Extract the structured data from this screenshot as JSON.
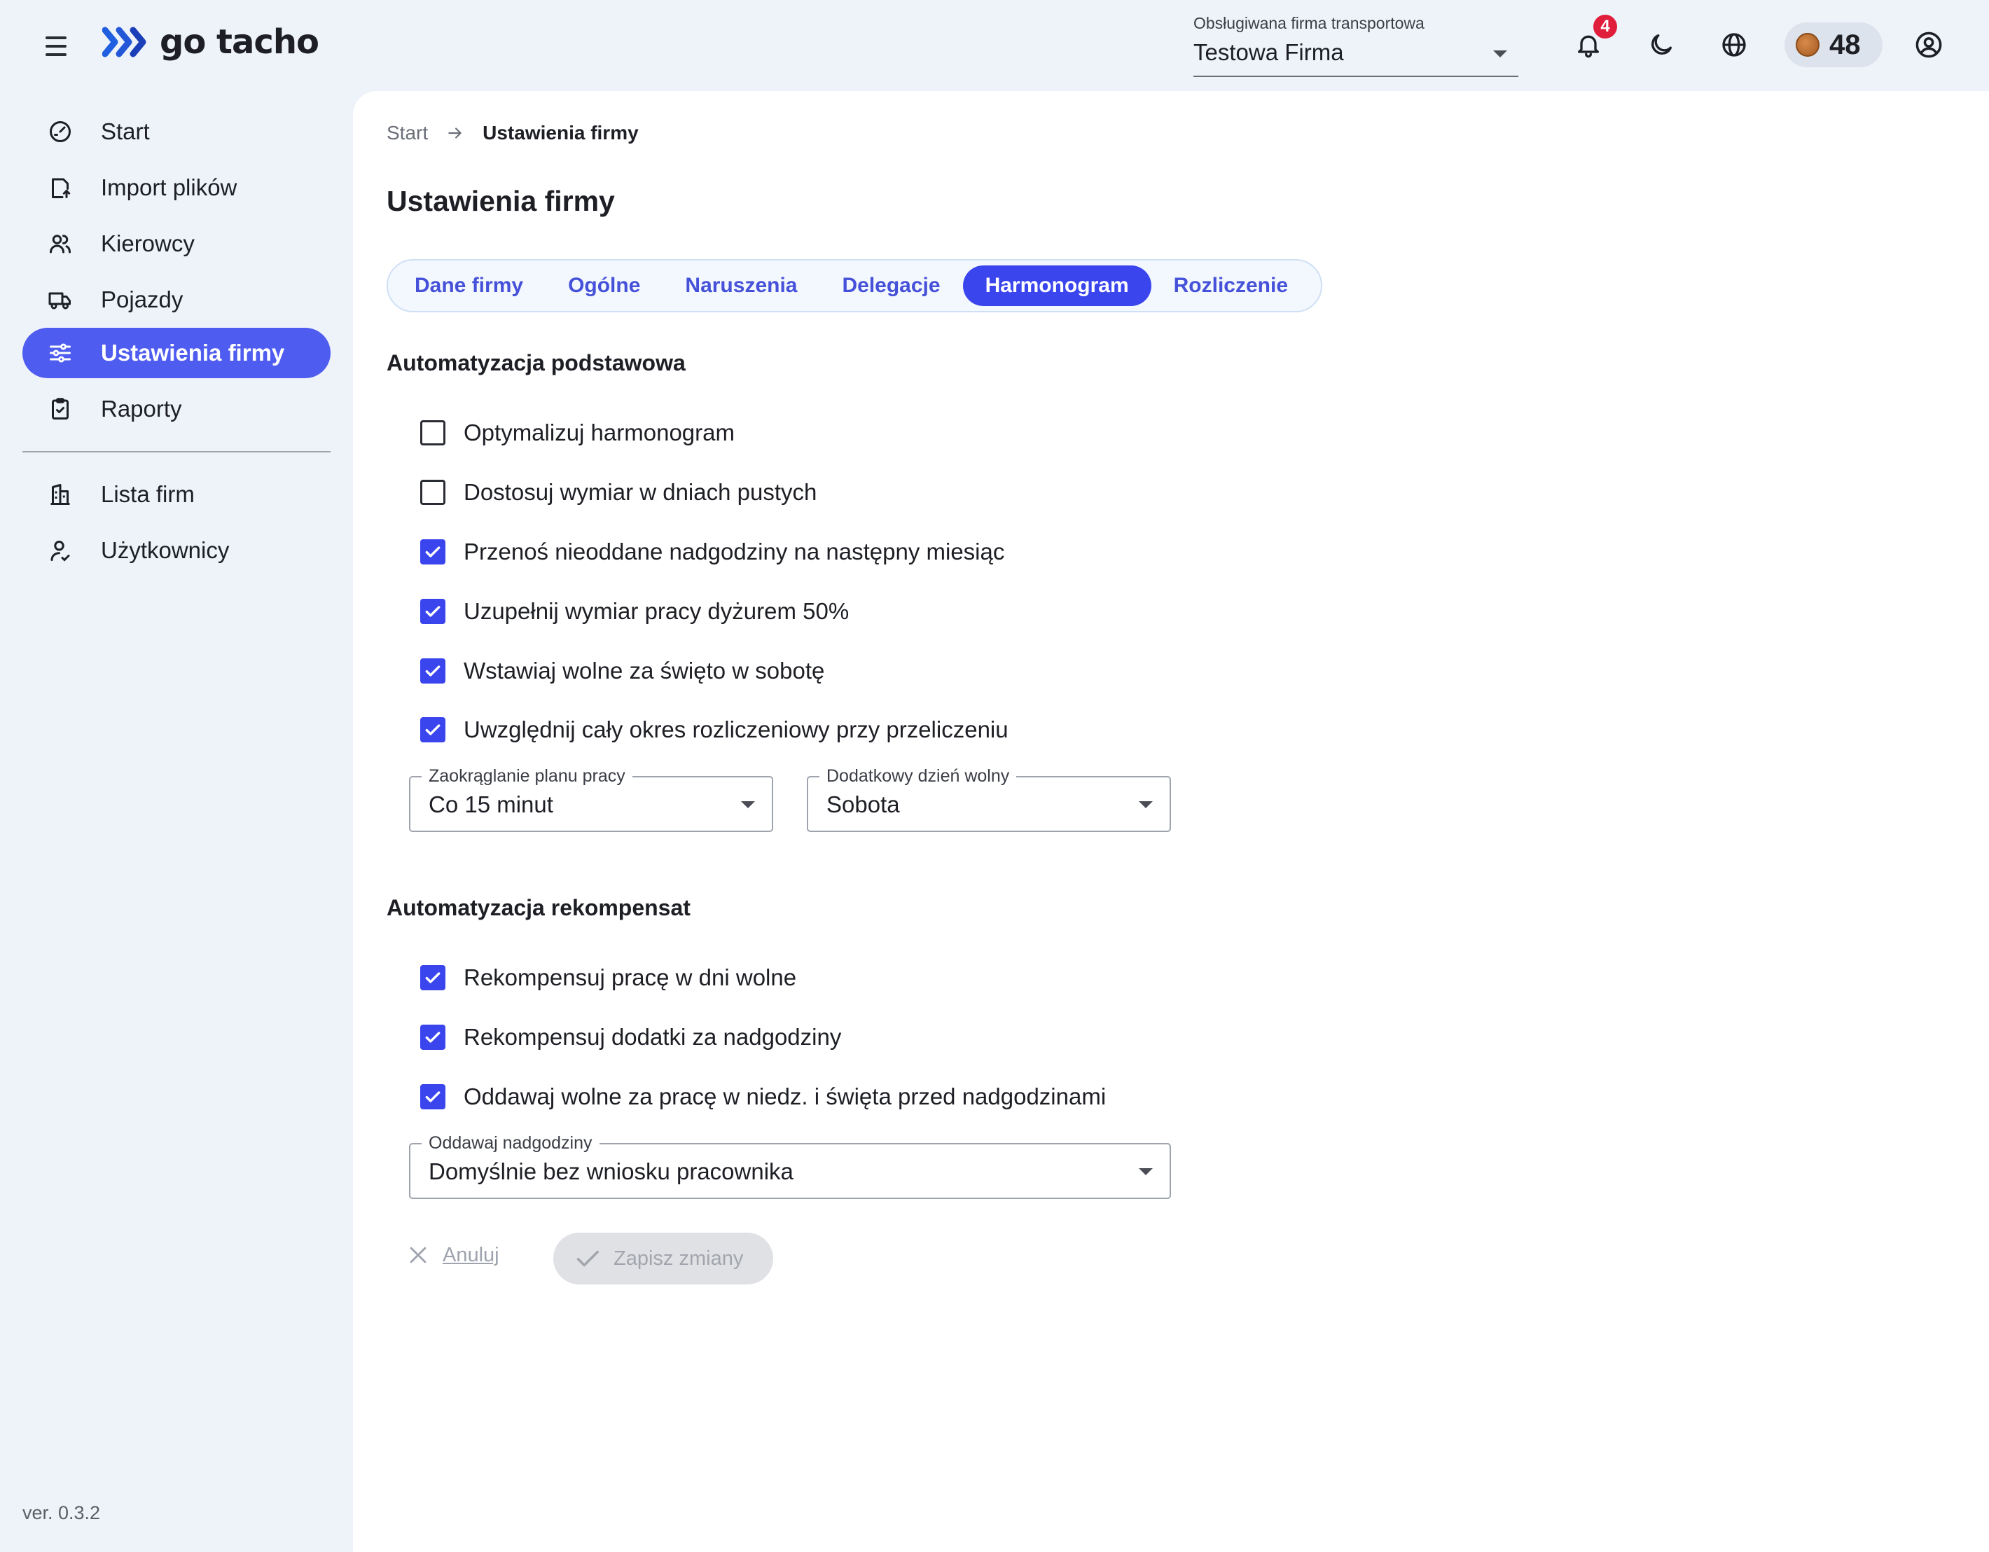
{
  "app": {
    "name": "go tacho",
    "version": "ver. 0.3.2"
  },
  "header": {
    "company_select_label": "Obsługiwana firma transportowa",
    "company_select_value": "Testowa Firma",
    "notifications_count": "4",
    "coins": "48"
  },
  "sidebar": {
    "items": [
      {
        "label": "Start",
        "icon": "speedometer-icon"
      },
      {
        "label": "Import plików",
        "icon": "file-import-icon"
      },
      {
        "label": "Kierowcy",
        "icon": "users-icon"
      },
      {
        "label": "Pojazdy",
        "icon": "truck-icon"
      },
      {
        "label": "Ustawienia firmy",
        "icon": "sliders-icon",
        "active": true
      },
      {
        "label": "Raporty",
        "icon": "clipboard-icon"
      }
    ],
    "secondary_items": [
      {
        "label": "Lista firm",
        "icon": "building-icon"
      },
      {
        "label": "Użytkownicy",
        "icon": "user-icon"
      }
    ]
  },
  "breadcrumb": {
    "start": "Start",
    "current": "Ustawienia firmy"
  },
  "page_title": "Ustawienia firmy",
  "tabs": [
    {
      "label": "Dane firmy"
    },
    {
      "label": "Ogólne"
    },
    {
      "label": "Naruszenia"
    },
    {
      "label": "Delegacje"
    },
    {
      "label": "Harmonogram",
      "active": true
    },
    {
      "label": "Rozliczenie"
    }
  ],
  "section_basic": {
    "title": "Automatyzacja podstawowa",
    "options": [
      {
        "label": "Optymalizuj harmonogram",
        "checked": false
      },
      {
        "label": "Dostosuj wymiar w dniach pustych",
        "checked": false
      },
      {
        "label": "Przenoś nieoddane nadgodziny na następny miesiąc",
        "checked": true
      },
      {
        "label": "Uzupełnij wymiar pracy dyżurem 50%",
        "checked": true
      },
      {
        "label": "Wstawiaj wolne za święto w sobotę",
        "checked": true
      },
      {
        "label": "Uwzględnij cały okres rozliczeniowy przy przeliczeniu",
        "checked": true
      }
    ],
    "rounding": {
      "label": "Zaokrąglanie planu pracy",
      "value": "Co 15 minut"
    },
    "extra_day_off": {
      "label": "Dodatkowy dzień wolny",
      "value": "Sobota"
    }
  },
  "section_comp": {
    "title": "Automatyzacja rekompensat",
    "options": [
      {
        "label": "Rekompensuj pracę w dni wolne",
        "checked": true
      },
      {
        "label": "Rekompensuj dodatki za nadgodziny",
        "checked": true
      },
      {
        "label": "Oddawaj wolne za pracę w niedz. i święta przed nadgodzinami",
        "checked": true
      }
    ],
    "overtime": {
      "label": "Oddawaj nadgodziny",
      "value": "Domyślnie bez wniosku pracownika"
    }
  },
  "actions": {
    "cancel": "Anuluj",
    "save": "Zapisz zmiany"
  },
  "colors": {
    "accent": "#3a45ee",
    "sidebar_active": "#4f5cf0",
    "badge": "#e11d3c",
    "background": "#eef3fa"
  }
}
